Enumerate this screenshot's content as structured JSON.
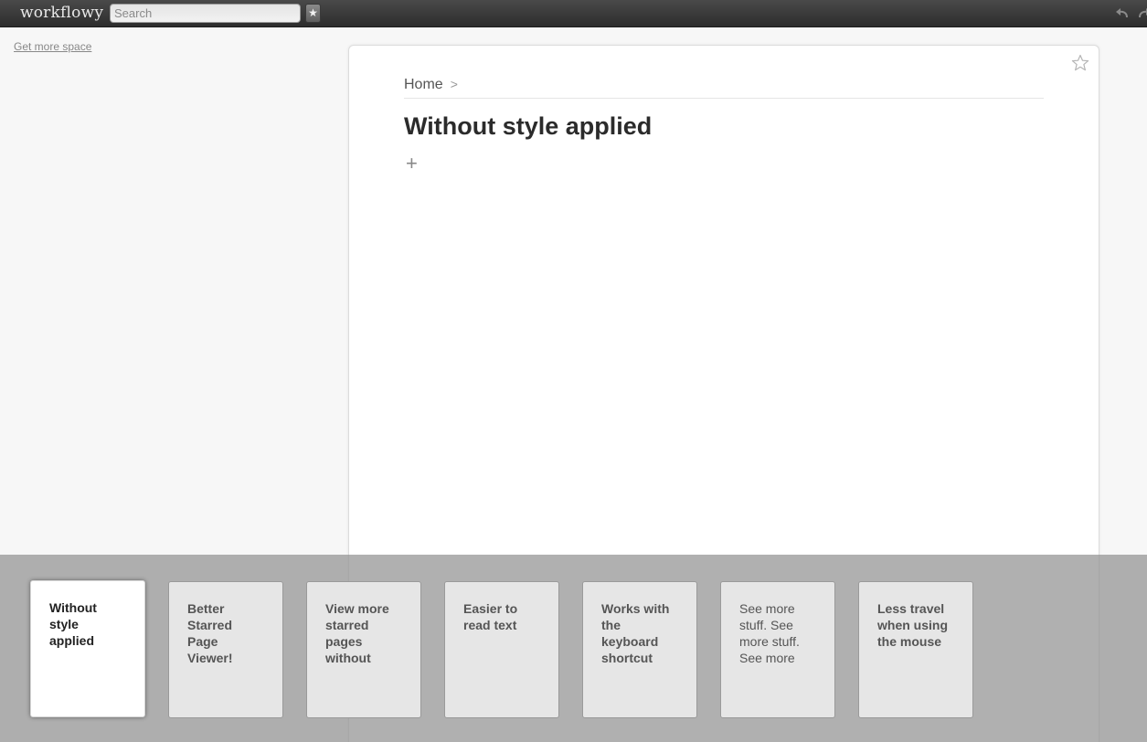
{
  "app": {
    "logo": "workflowy"
  },
  "search": {
    "placeholder": "Search",
    "value": ""
  },
  "toolbar": {
    "star_label": "★"
  },
  "sidebar": {
    "get_more_space": "Get more space"
  },
  "breadcrumb": {
    "home": "Home",
    "separator": ">"
  },
  "page": {
    "title": "Without style applied",
    "add_label": "+"
  },
  "thumbnails": [
    {
      "lines": [
        "Without",
        "style",
        "applied"
      ],
      "active": true,
      "bold": true
    },
    {
      "lines": [
        "Better",
        "Starred",
        "Page",
        "Viewer!"
      ],
      "active": false,
      "bold": true
    },
    {
      "lines": [
        "View more",
        "starred",
        "pages",
        "without"
      ],
      "active": false,
      "bold": true
    },
    {
      "lines": [
        "Easier to",
        "read text"
      ],
      "active": false,
      "bold": true
    },
    {
      "lines": [
        "Works with",
        "the",
        "keyboard",
        "shortcut"
      ],
      "active": false,
      "bold": true
    },
    {
      "lines": [
        "See more",
        "stuff. See",
        "more stuff.",
        "See more"
      ],
      "active": false,
      "bold": false
    },
    {
      "lines": [
        "Less travel",
        "when using",
        "the mouse"
      ],
      "active": false,
      "bold": true
    }
  ],
  "icons": {
    "star_button": "star-icon",
    "undo": "undo-icon",
    "redo": "redo-icon",
    "page_star": "star-outline-icon"
  },
  "colors": {
    "topbar": "#333333",
    "page_bg": "#ffffff",
    "overlay": "#9a9a9a",
    "thumb_bg": "#e6e6e6"
  }
}
